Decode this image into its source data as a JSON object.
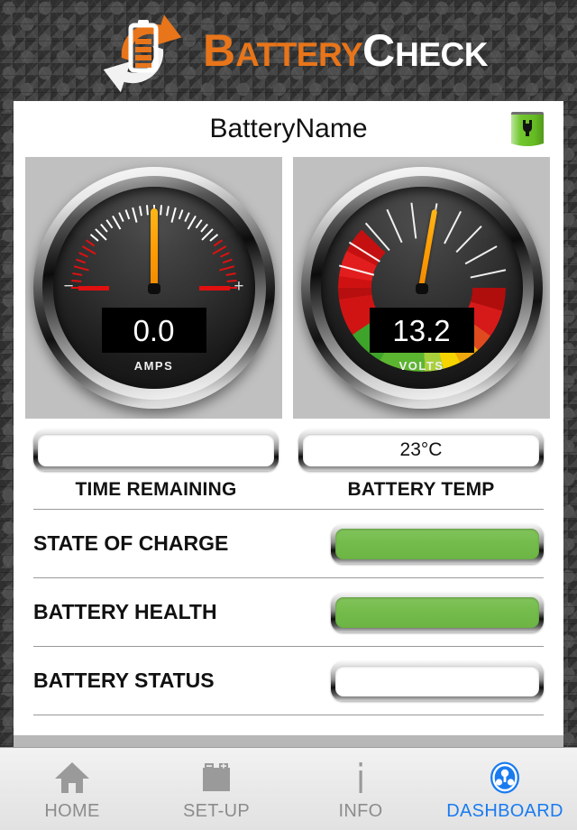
{
  "app": {
    "logo": {
      "word1_cap": "B",
      "word1_rest": "ATTERY",
      "word2_cap": "C",
      "word2_rest": "HECK",
      "brand_orange": "#e8751a",
      "brand_white": "#ffffff",
      "icon": "battery-recycle-logo-icon"
    }
  },
  "header": {
    "title": "BatteryName",
    "status_icon": "green-battery-plug-icon"
  },
  "gauges": [
    {
      "name": "amps-gauge",
      "value": "0.0",
      "unit": "AMPS",
      "needle_angle_deg": 0,
      "scale_min_label": "−",
      "scale_max_label": "+"
    },
    {
      "name": "volts-gauge",
      "value": "13.2",
      "unit": "VOLTS",
      "needle_angle_deg": 10
    }
  ],
  "fields": [
    {
      "name": "time-remaining",
      "value": "",
      "label": "TIME REMAINING",
      "filled": false
    },
    {
      "name": "battery-temp",
      "value": "23°C",
      "label": "BATTERY TEMP",
      "filled": false
    }
  ],
  "rows": [
    {
      "name": "state-of-charge",
      "label": "STATE OF CHARGE",
      "value": "",
      "state": "green"
    },
    {
      "name": "battery-health",
      "label": "BATTERY HEALTH",
      "value": "",
      "state": "green"
    },
    {
      "name": "battery-status",
      "label": "BATTERY STATUS",
      "value": "",
      "state": "empty"
    }
  ],
  "nav": {
    "items": [
      {
        "label": "HOME",
        "icon": "home-icon",
        "active": false
      },
      {
        "label": "SET-UP",
        "icon": "battery-icon",
        "active": false
      },
      {
        "label": "INFO",
        "icon": "info-icon",
        "active": false
      },
      {
        "label": "DASHBOARD",
        "icon": "dashboard-icon",
        "active": true
      }
    ],
    "active_color": "#1a7bf0",
    "inactive_color": "#8c8c8c"
  }
}
